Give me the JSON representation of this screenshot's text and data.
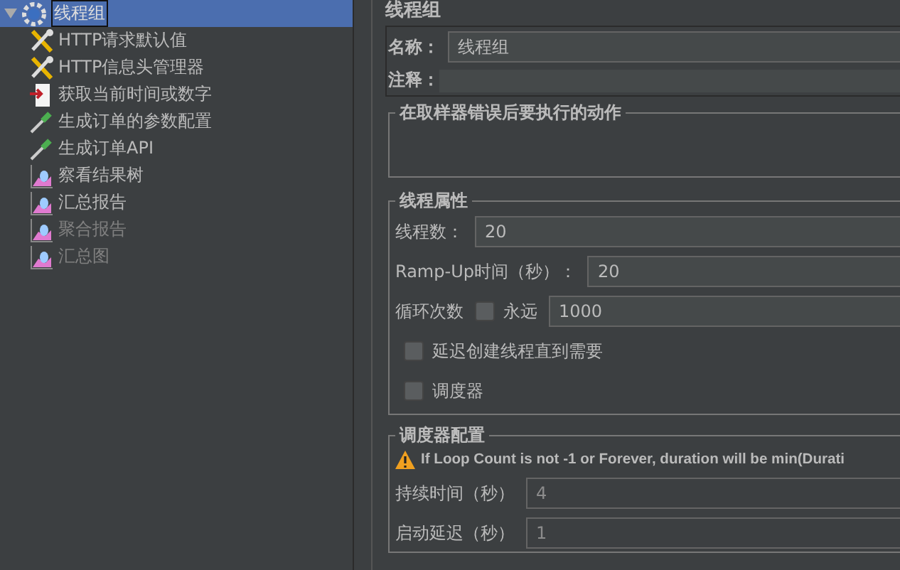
{
  "tree": {
    "root": {
      "label": "线程组",
      "selected": true,
      "expanded": true,
      "children": [
        {
          "label": "HTTP请求默认值",
          "kind": "tool",
          "disabled": false
        },
        {
          "label": "HTTP信息头管理器",
          "kind": "tool",
          "disabled": false
        },
        {
          "label": "获取当前时间或数字",
          "kind": "timer",
          "disabled": false
        },
        {
          "label": "生成订单的参数配置",
          "kind": "dropper",
          "disabled": false
        },
        {
          "label": "生成订单API",
          "kind": "dropper",
          "disabled": false
        },
        {
          "label": "察看结果树",
          "kind": "graph",
          "disabled": false
        },
        {
          "label": "汇总报告",
          "kind": "graph",
          "disabled": false
        },
        {
          "label": "聚合报告",
          "kind": "graph",
          "disabled": true
        },
        {
          "label": "汇总图",
          "kind": "graph",
          "disabled": true
        }
      ]
    }
  },
  "panel": {
    "title": "线程组",
    "name": {
      "label": "名称：",
      "value": "线程组"
    },
    "comment": {
      "label": "注释："
    },
    "error_action": {
      "title": "在取样器错误后要执行的动作"
    },
    "thread_properties": {
      "title": "线程属性",
      "fields": [
        {
          "label": "线程数：",
          "value": "20"
        },
        {
          "label": "Ramp-Up时间（秒）：",
          "value": "20"
        }
      ],
      "loop": {
        "label": "循环次数",
        "forever": {
          "label": "永远",
          "checked": false
        },
        "value": "1000"
      },
      "options": [
        {
          "label": "延迟创建线程直到需要",
          "checked": false
        },
        {
          "label": "调度器",
          "checked": false
        }
      ]
    },
    "scheduler": {
      "title": "调度器配置",
      "warning": "If Loop Count is not -1 or Forever, duration will be min(Durati",
      "fields": [
        {
          "label": "持续时间（秒）",
          "value": "4",
          "disabled": true
        },
        {
          "label": "启动延迟（秒）",
          "value": "1",
          "disabled": true
        }
      ]
    }
  }
}
